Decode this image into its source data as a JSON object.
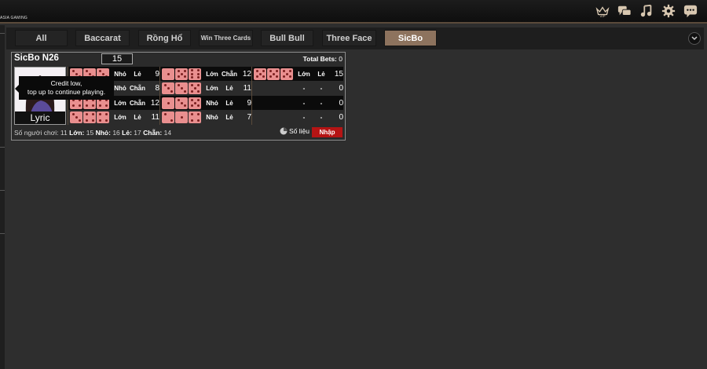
{
  "header": {
    "brand": "ASIA GAMING",
    "icons": [
      "vip-crown-icon",
      "chat-bubbles-icon",
      "music-icon",
      "settings-gear-icon",
      "message-icon"
    ]
  },
  "tabs": [
    {
      "label": "All",
      "active": false
    },
    {
      "label": "Baccarat",
      "active": false
    },
    {
      "label": "Rồng Hổ",
      "active": false
    },
    {
      "label": "Win Three Cards",
      "active": false
    },
    {
      "label": "Bull Bull",
      "active": false
    },
    {
      "label": "Three Face",
      "active": false
    },
    {
      "label": "SicBo",
      "active": true
    }
  ],
  "table": {
    "title": "SicBo N26",
    "timer": "15",
    "total_bets_label": "Total Bets:",
    "total_bets_value": "0",
    "dealer_name": "Lyric",
    "tooltip_line1": "Credit low,",
    "tooltip_line2": "top up to continue playing.",
    "columns": [
      [
        {
          "dice": [
            3,
            3,
            3
          ],
          "size": "Nhỏ",
          "parity": "Lẻ",
          "total": "9"
        },
        {
          "dice": [
            2,
            2,
            4
          ],
          "size": "Nhỏ",
          "parity": "Chẵn",
          "total": "8"
        },
        {
          "dice": [
            4,
            4,
            4
          ],
          "size": "Lớn",
          "parity": "Chẵn",
          "total": "12"
        },
        {
          "dice": [
            3,
            4,
            4
          ],
          "size": "Lớn",
          "parity": "Lẻ",
          "total": "11"
        }
      ],
      [
        {
          "dice": [
            1,
            5,
            6
          ],
          "size": "Lớn",
          "parity": "Chẵn",
          "total": "12"
        },
        {
          "dice": [
            3,
            3,
            5
          ],
          "size": "Lớn",
          "parity": "Lẻ",
          "total": "11"
        },
        {
          "dice": [
            1,
            3,
            5
          ],
          "size": "Nhỏ",
          "parity": "Lẻ",
          "total": "9"
        },
        {
          "dice": [
            2,
            1,
            4
          ],
          "size": "Nhỏ",
          "parity": "Lẻ",
          "total": "7"
        }
      ],
      [
        {
          "dice": [
            5,
            5,
            5
          ],
          "size": "Lớn",
          "parity": "Lẻ",
          "total": "15"
        },
        {
          "dice": [],
          "size": "-",
          "parity": "-",
          "total": "0"
        },
        {
          "dice": [],
          "size": "-",
          "parity": "-",
          "total": "0"
        },
        {
          "dice": [],
          "size": "-",
          "parity": "-",
          "total": "0"
        }
      ]
    ],
    "footer": {
      "players_label": "Số người chơi:",
      "players": "11",
      "big_label": "Lớn:",
      "big": "15",
      "small_label": "Nhỏ:",
      "small": "16",
      "odd_label": "Lẻ:",
      "odd": "17",
      "even_label": "Chẵn:",
      "even": "14"
    },
    "stats_label": "Số liệu",
    "enter_label": "Nhập"
  }
}
